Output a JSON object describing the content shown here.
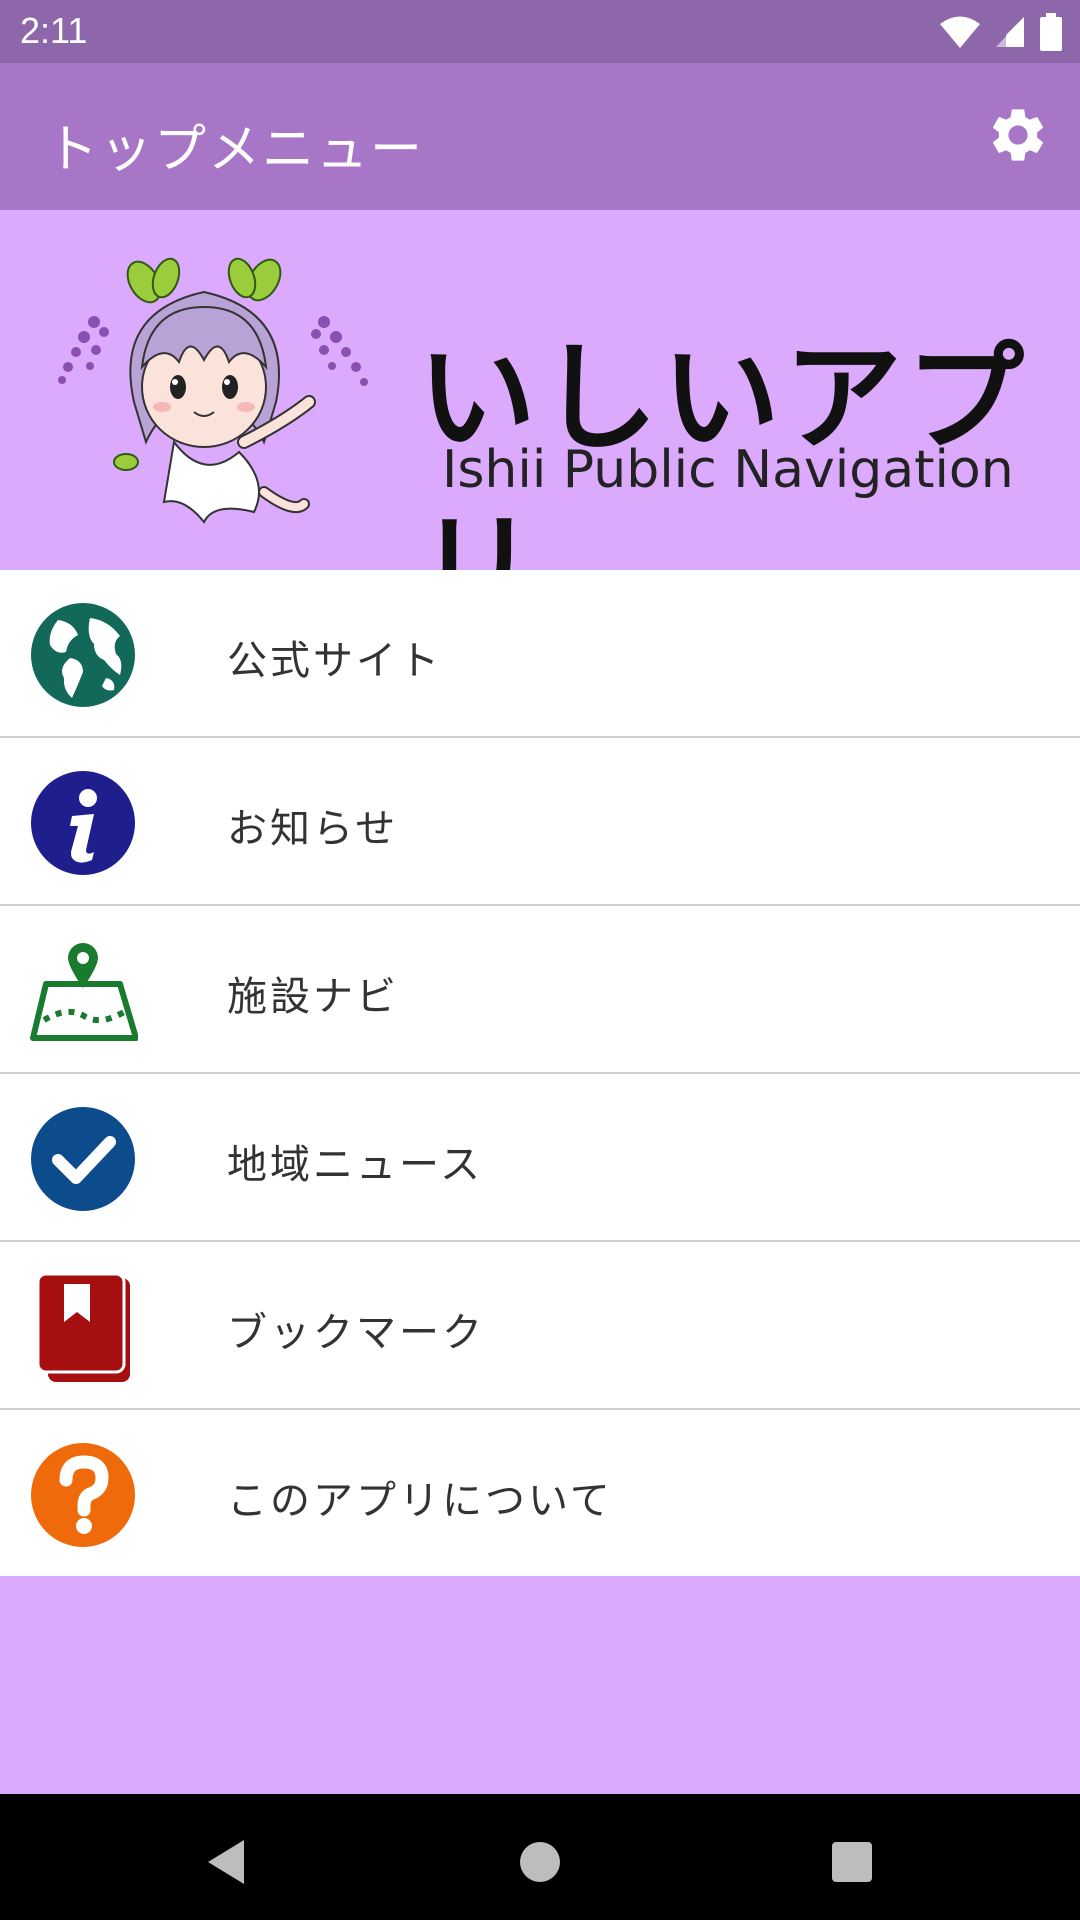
{
  "status_bar": {
    "time": "2:11",
    "icons": [
      "wifi-icon",
      "cellular-signal-icon",
      "battery-icon"
    ]
  },
  "app_bar": {
    "title": "トップメニュー",
    "settings_icon": "gear-icon"
  },
  "banner": {
    "title": "いしいアプリ",
    "subtitle": "Ishii Public Navigation",
    "mascot": "wisteria-fairy-mascot"
  },
  "menu": {
    "items": [
      {
        "label": "公式サイト",
        "icon": "globe-icon",
        "color": "#12695a"
      },
      {
        "label": "お知らせ",
        "icon": "info-icon",
        "color": "#1e1e8c"
      },
      {
        "label": "施設ナビ",
        "icon": "map-pin-icon",
        "color": "#1a7a2e"
      },
      {
        "label": "地域ニュース",
        "icon": "check-icon",
        "color": "#0d4c8c"
      },
      {
        "label": "ブックマーク",
        "icon": "bookmark-book-icon",
        "color": "#a50f0f"
      },
      {
        "label": "このアプリについて",
        "icon": "question-icon",
        "color": "#ee6a0a"
      }
    ]
  },
  "colors": {
    "status_bar": "#8d67a9",
    "app_bar": "#a876c6",
    "background": "#dcaafc"
  },
  "nav_bar": {
    "buttons": [
      "back-icon",
      "home-icon",
      "recents-icon"
    ]
  }
}
